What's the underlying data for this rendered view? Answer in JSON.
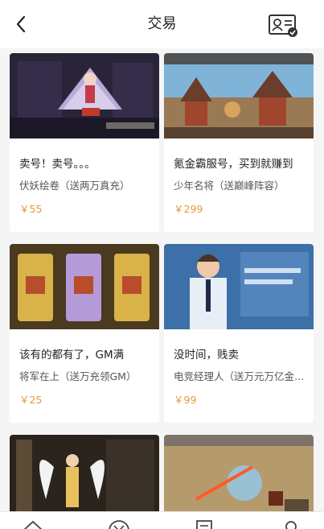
{
  "header": {
    "title": "交易",
    "back_icon": "chevron-left-icon",
    "right_icon": "id-card-check-icon"
  },
  "listings": [
    {
      "name": "卖号！卖号。。。",
      "desc": "伏妖绘卷（送两万真充）",
      "price": "￥55"
    },
    {
      "name": "氪金霸服号，买到就赚到",
      "desc": "少年名将（送巅峰阵容）",
      "price": "￥299"
    },
    {
      "name": "该有的都有了，GM满",
      "desc": "将军在上（送万充领GM）",
      "price": "￥25"
    },
    {
      "name": "没时间，贱卖",
      "desc": "电竞经理人（送万元万亿金币）",
      "price": "￥99"
    },
    {
      "name": "",
      "desc": "",
      "price": ""
    },
    {
      "name": "",
      "desc": "",
      "price": ""
    }
  ],
  "tabbar": {
    "icons": [
      "home-icon",
      "game-icon",
      "document-icon",
      "profile-icon"
    ]
  },
  "colors": {
    "price": "#e49a3a",
    "background": "#f5f5f5",
    "card": "#ffffff"
  }
}
